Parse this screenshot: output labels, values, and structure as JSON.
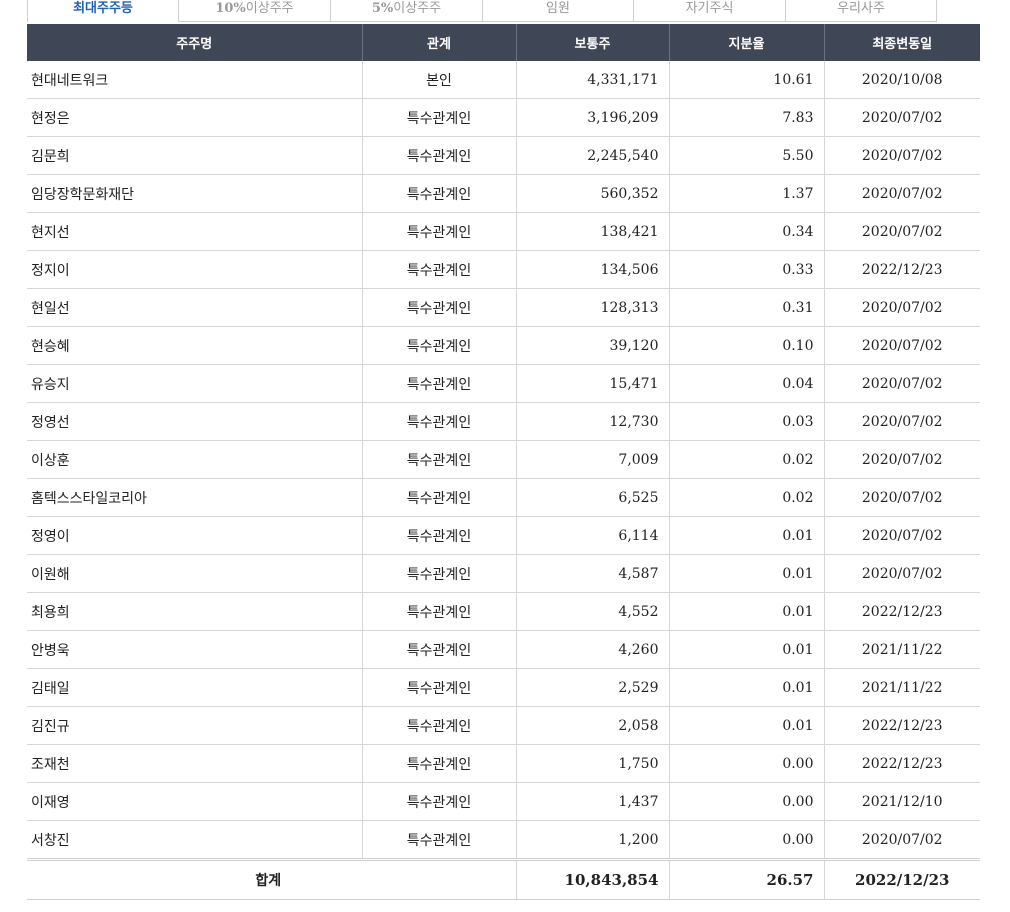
{
  "tabs": [
    {
      "label": "최대주주등"
    },
    {
      "num": "10%",
      "label": "이상주주"
    },
    {
      "num": "5%",
      "label": "이상주주"
    },
    {
      "label": "임원"
    },
    {
      "label": "자기주식"
    },
    {
      "label": "우리사주"
    }
  ],
  "table": {
    "headers": [
      "주주명",
      "관계",
      "보통주",
      "지분율",
      "최종변동일"
    ],
    "rows": [
      [
        "현대네트워크",
        "본인",
        "4,331,171",
        "10.61",
        "2020/10/08"
      ],
      [
        "현정은",
        "특수관계인",
        "3,196,209",
        "7.83",
        "2020/07/02"
      ],
      [
        "김문희",
        "특수관계인",
        "2,245,540",
        "5.50",
        "2020/07/02"
      ],
      [
        "임당장학문화재단",
        "특수관계인",
        "560,352",
        "1.37",
        "2020/07/02"
      ],
      [
        "현지선",
        "특수관계인",
        "138,421",
        "0.34",
        "2020/07/02"
      ],
      [
        "정지이",
        "특수관계인",
        "134,506",
        "0.33",
        "2022/12/23"
      ],
      [
        "현일선",
        "특수관계인",
        "128,313",
        "0.31",
        "2020/07/02"
      ],
      [
        "현승혜",
        "특수관계인",
        "39,120",
        "0.10",
        "2020/07/02"
      ],
      [
        "유승지",
        "특수관계인",
        "15,471",
        "0.04",
        "2020/07/02"
      ],
      [
        "정영선",
        "특수관계인",
        "12,730",
        "0.03",
        "2020/07/02"
      ],
      [
        "이상훈",
        "특수관계인",
        "7,009",
        "0.02",
        "2020/07/02"
      ],
      [
        "홈텍스스타일코리아",
        "특수관계인",
        "6,525",
        "0.02",
        "2020/07/02"
      ],
      [
        "정영이",
        "특수관계인",
        "6,114",
        "0.01",
        "2020/07/02"
      ],
      [
        "이원해",
        "특수관계인",
        "4,587",
        "0.01",
        "2020/07/02"
      ],
      [
        "최용희",
        "특수관계인",
        "4,552",
        "0.01",
        "2022/12/23"
      ],
      [
        "안병욱",
        "특수관계인",
        "4,260",
        "0.01",
        "2021/11/22"
      ],
      [
        "김태일",
        "특수관계인",
        "2,529",
        "0.01",
        "2021/11/22"
      ],
      [
        "김진규",
        "특수관계인",
        "2,058",
        "0.01",
        "2022/12/23"
      ],
      [
        "조재천",
        "특수관계인",
        "1,750",
        "0.00",
        "2022/12/23"
      ],
      [
        "이재영",
        "특수관계인",
        "1,437",
        "0.00",
        "2021/12/10"
      ],
      [
        "서창진",
        "특수관계인",
        "1,200",
        "0.00",
        "2020/07/02"
      ]
    ],
    "total": {
      "label": "합계",
      "shares": "10,843,854",
      "ratio": "26.57",
      "date": "2022/12/23"
    }
  },
  "colors": {
    "header_bg": "#3f4757",
    "active_tab": "#2162b8"
  }
}
